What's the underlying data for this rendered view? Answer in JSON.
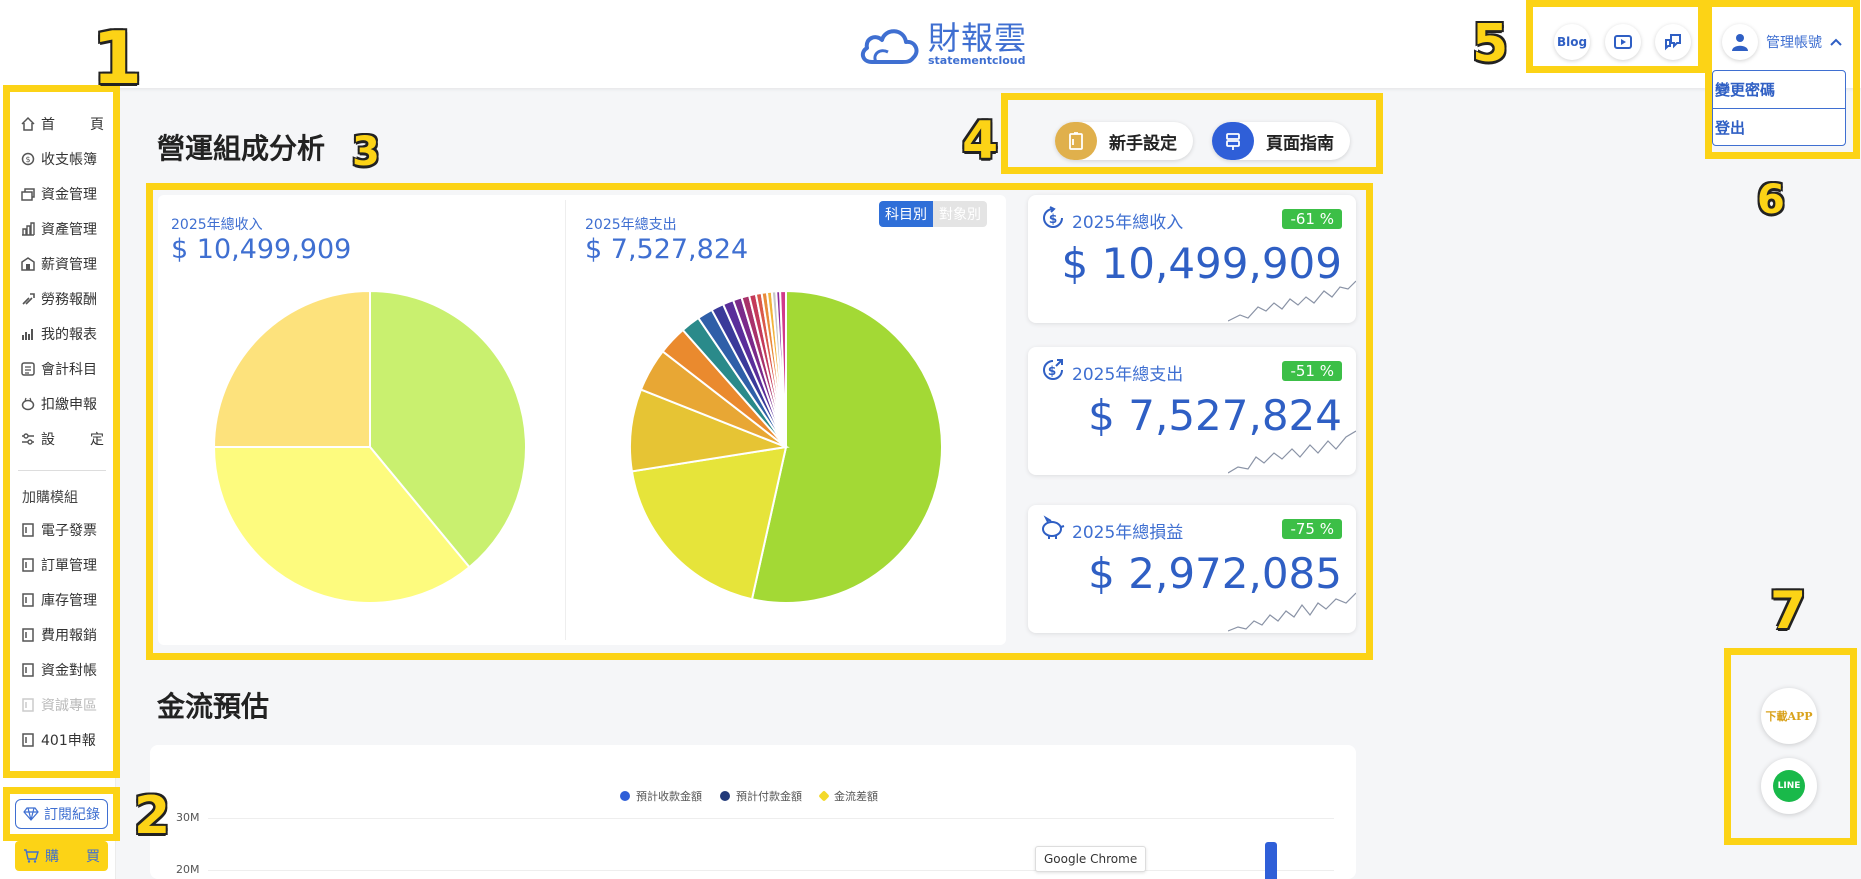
{
  "header": {
    "logo_zh": "財報雲",
    "logo_en": "statementcloud",
    "blog_label": "Blog",
    "account_label": "管理帳號",
    "account_menu": [
      "變更密碼",
      "登出"
    ]
  },
  "annotations": [
    "1",
    "2",
    "3",
    "4",
    "5",
    "6",
    "7"
  ],
  "sidebar": {
    "items": [
      {
        "label": "首頁",
        "chars": [
          "首",
          "頁"
        ],
        "icon": "home-icon"
      },
      {
        "label": "收支帳簿",
        "icon": "ledger-icon"
      },
      {
        "label": "資金管理",
        "icon": "funds-icon"
      },
      {
        "label": "資產管理",
        "icon": "assets-icon"
      },
      {
        "label": "薪資管理",
        "icon": "payroll-icon"
      },
      {
        "label": "勞務報酬",
        "icon": "service-fee-icon"
      },
      {
        "label": "我的報表",
        "icon": "report-icon"
      },
      {
        "label": "會計科目",
        "icon": "accounts-icon"
      },
      {
        "label": "扣繳申報",
        "icon": "withholding-icon"
      },
      {
        "label": "設定",
        "chars": [
          "設",
          "定"
        ],
        "icon": "settings-icon"
      }
    ],
    "addon_title": "加購模組",
    "addons": [
      {
        "label": "電子發票",
        "disabled": false
      },
      {
        "label": "訂單管理",
        "disabled": false
      },
      {
        "label": "庫存管理",
        "disabled": false
      },
      {
        "label": "費用報銷",
        "disabled": false
      },
      {
        "label": "資金對帳",
        "disabled": false
      },
      {
        "label": "資誠專區",
        "disabled": true
      },
      {
        "label": "401申報",
        "disabled": false
      }
    ],
    "subscription_label": "訂閱紀錄",
    "buy_chars": [
      "購",
      "買"
    ]
  },
  "page": {
    "title": "營運組成分析",
    "onboarding_label": "新手設定",
    "guide_label": "頁面指南"
  },
  "pies": {
    "income_label": "2025年總收入",
    "income_value": "$ 10,499,909",
    "expense_label": "2025年總支出",
    "expense_value": "$ 7,527,824",
    "toggle": [
      "科目別",
      "對象別"
    ]
  },
  "stats": [
    {
      "label": "2025年總收入",
      "badge": "-61 %",
      "value": "$ 10,499,909",
      "icon": "dollar-refresh-icon"
    },
    {
      "label": "2025年總支出",
      "badge": "-51 %",
      "value": "$ 7,527,824",
      "icon": "dollar-out-icon"
    },
    {
      "label": "2025年總損益",
      "badge": "-75 %",
      "value": "$ 2,972,085",
      "icon": "piggy-bank-icon"
    }
  ],
  "cashflow": {
    "title": "金流預估",
    "legend": [
      {
        "label": "預計收款金額",
        "color": "#2f5fd8"
      },
      {
        "label": "預計付款金額",
        "color": "#223a7a"
      },
      {
        "label": "金流差額",
        "color": "#f3d92c"
      }
    ],
    "y_ticks": [
      "30M",
      "20M"
    ],
    "tooltip": "Google Chrome"
  },
  "floating": {
    "download_label": "下載APP",
    "line_label": "LINE"
  },
  "chart_data": [
    {
      "type": "pie",
      "title": "2025年總收入",
      "colors": [
        "#c9f06f",
        "#fdfb7e",
        "#fde27c"
      ],
      "values": [
        39,
        36,
        25
      ]
    },
    {
      "type": "pie",
      "title": "2025年總支出",
      "colors": [
        "#a3d935",
        "#e6e43a",
        "#e6c434",
        "#e8a734",
        "#ea8a2e",
        "#2a8a8a",
        "#2f5fa8",
        "#3b3a9a",
        "#5a2e9a",
        "#7a2a8a",
        "#a8326a",
        "#c43a5a",
        "#d9584a",
        "#e88a3a",
        "#f2b33a",
        "#c8c8c8",
        "#8b2a9a",
        "#d23a8a"
      ],
      "values": [
        53.5,
        19,
        8.5,
        4.5,
        3,
        2,
        1.6,
        1.3,
        1.1,
        0.9,
        0.8,
        0.7,
        0.6,
        0.55,
        0.5,
        0.45,
        0.4,
        0.6
      ]
    }
  ]
}
